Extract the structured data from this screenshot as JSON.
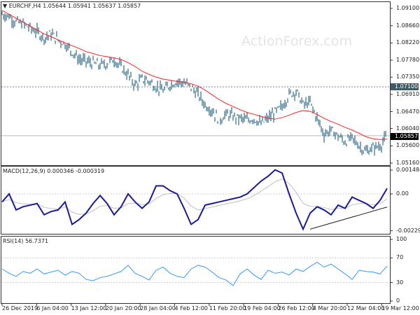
{
  "header": {
    "symbol": "EURCHF,H4",
    "open": "1.05644",
    "high": "1.05941",
    "low": "1.05637",
    "close": "1.05857"
  },
  "watermark": "ActionForex.com",
  "colors": {
    "bars": "#2f6a88",
    "ma": "#ff2020",
    "macd": "#1a1a9a",
    "signal": "#c0c0c0",
    "rsi": "#3399ff",
    "level": "#9aa"
  },
  "chart_data": [
    {
      "type": "bar",
      "title": "EURCHF,H4",
      "ylim": [
        1.0516,
        1.091
      ],
      "y_ticks": [
        "1.09100",
        "1.08660",
        "1.08220",
        "1.07780",
        "1.07350",
        "1.06910",
        "1.06470",
        "1.06040",
        "1.05600",
        "1.05160"
      ],
      "level_label": "1.07100",
      "level": 1.071,
      "last_label": "1.05857",
      "last": 1.05857,
      "close": [
        1.0895,
        1.089,
        1.0875,
        1.087,
        1.086,
        1.085,
        1.0835,
        1.0845,
        1.083,
        1.082,
        1.08,
        1.078,
        1.0775,
        1.077,
        1.0765,
        1.077,
        1.078,
        1.076,
        1.074,
        1.0715,
        1.073,
        1.0725,
        1.071,
        1.07,
        1.0715,
        1.0725,
        1.072,
        1.071,
        1.069,
        1.0665,
        1.065,
        1.0625,
        1.064,
        1.0635,
        1.063,
        1.0625,
        1.063,
        1.0615,
        1.063,
        1.0645,
        1.066,
        1.069,
        1.07,
        1.0665,
        1.067,
        1.063,
        1.059,
        1.06,
        1.0585,
        1.057,
        1.058,
        1.056,
        1.0545,
        1.0555,
        1.056,
        1.05857
      ],
      "ma": [
        1.0905,
        1.0895,
        1.0885,
        1.0875,
        1.0865,
        1.0855,
        1.0845,
        1.0838,
        1.083,
        1.0822,
        1.0815,
        1.0808,
        1.08,
        1.0795,
        1.079,
        1.0787,
        1.0784,
        1.078,
        1.0772,
        1.0762,
        1.075,
        1.0742,
        1.0735,
        1.073,
        1.0727,
        1.0724,
        1.0722,
        1.0718,
        1.0712,
        1.0702,
        1.069,
        1.0678,
        1.0668,
        1.066,
        1.0652,
        1.0645,
        1.064,
        1.0635,
        1.063,
        1.0628,
        1.0632,
        1.0638,
        1.0645,
        1.065,
        1.0648,
        1.064,
        1.063,
        1.0622,
        1.0615,
        1.0607,
        1.06,
        1.0592,
        1.0583,
        1.0578,
        1.0576,
        1.0577
      ]
    },
    {
      "type": "line",
      "title": "MACD(12,26,9) 0.000346 -0.000319",
      "ylim": [
        -0.002297,
        0.001484
      ],
      "y_ticks": [
        "0.001484",
        "0.00",
        "-0.002297"
      ],
      "macd": [
        -0.0005,
        0.0,
        -0.001,
        -0.0008,
        -0.0007,
        -0.0006,
        -0.0013,
        -0.0011,
        -0.001,
        -0.0005,
        -0.0019,
        -0.0016,
        -0.0012,
        -0.0006,
        -0.0001,
        -0.0006,
        -0.0013,
        -0.0008,
        0.0,
        -0.0005,
        -0.0009,
        -0.0005,
        0.0005,
        0.0005,
        0.0002,
        0.0,
        -0.0009,
        -0.0019,
        -0.0016,
        -0.0007,
        -0.0006,
        -0.0005,
        -0.0004,
        -0.0003,
        -0.0002,
        0.0,
        0.0004,
        0.0008,
        0.0011,
        0.0015,
        0.0013,
        0.0,
        -0.0012,
        -0.0022,
        -0.0012,
        -0.0008,
        -0.001,
        -0.0013,
        -0.0007,
        -0.0009,
        -0.0002,
        -0.0004,
        -0.0006,
        -0.0009,
        -0.0004,
        0.000346
      ],
      "trendline": [
        [
          44,
          -0.0022
        ],
        [
          55,
          -0.00082
        ]
      ]
    },
    {
      "type": "line",
      "title": "RSI(14) 56.7371",
      "ylim": [
        0,
        100
      ],
      "y_ticks": [
        "100",
        "70",
        "30",
        "0"
      ],
      "levels": [
        70,
        30
      ],
      "rsi": [
        52,
        45,
        40,
        48,
        45,
        52,
        44,
        47,
        50,
        42,
        48,
        45,
        35,
        33,
        38,
        40,
        44,
        48,
        58,
        45,
        40,
        34,
        50,
        55,
        45,
        40,
        38,
        52,
        58,
        55,
        47,
        38,
        34,
        25,
        44,
        52,
        42,
        35,
        50,
        45,
        47,
        42,
        52,
        48,
        56,
        63,
        55,
        60,
        52,
        44,
        35,
        50,
        48,
        47,
        44,
        56.7
      ]
    },
    {
      "type": "table",
      "x_ticks": [
        "26 Dec 2019",
        "6 Jan 04:00",
        "13 Jan 12:00",
        "20 Jan 20:00",
        "28 Jan 04:00",
        "4 Feb 12:00",
        "11 Feb 20:00",
        "19 Feb 04:00",
        "26 Feb 12:00",
        "4 Mar 20:00",
        "12 Mar 04:00",
        "19 Mar 12:00"
      ]
    }
  ]
}
